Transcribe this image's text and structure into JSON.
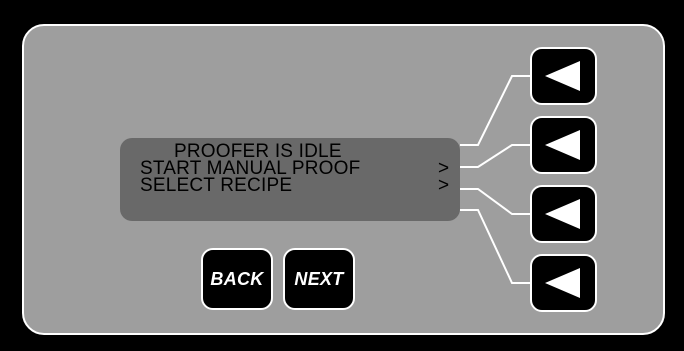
{
  "display": {
    "title": "PROOFER IS IDLE",
    "lines": [
      {
        "label": "START MANUAL PROOF",
        "arrow": ">"
      },
      {
        "label": "SELECT RECIPE",
        "arrow": ">"
      }
    ]
  },
  "buttons": {
    "back_label": "BACK",
    "next_label": "NEXT"
  },
  "softkeys": [
    {
      "icon": "left-triangle-icon"
    },
    {
      "icon": "left-triangle-icon"
    },
    {
      "icon": "left-triangle-icon"
    },
    {
      "icon": "left-triangle-icon"
    }
  ],
  "colors": {
    "panel": "#9e9e9e",
    "lcd": "#696969",
    "frame": "#000000",
    "outline": "#ffffff"
  }
}
